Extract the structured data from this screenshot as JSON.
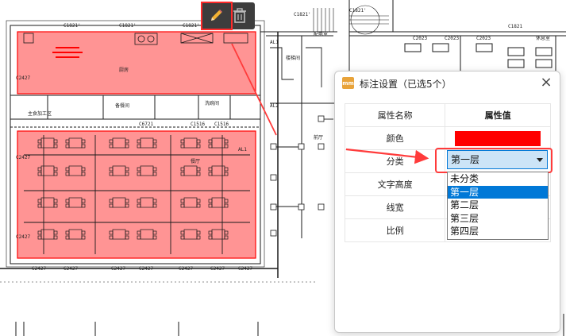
{
  "cad": {
    "labels": [
      "C1821'",
      "C1821'",
      "C1821'",
      "C1821'",
      "C2427",
      "C2427",
      "C2427",
      "C2427",
      "C2427",
      "C2427",
      "C2427",
      "C2427",
      "C2427",
      "C2427",
      "C1821'",
      "C1821'",
      "C6721",
      "C1516",
      "C1516",
      "AL1",
      "AL2",
      "AL1",
      "C1821",
      "C2023",
      "C2023",
      "C2023"
    ],
    "room_labels": [
      "厨房",
      "备餐间",
      "洗碗间",
      "主食加工区",
      "餐厅",
      "配电室",
      "楼梯间",
      "前厅",
      "休息室"
    ]
  },
  "toolbar": {
    "edit_icon": "pencil-icon",
    "delete_icon": "trash-icon"
  },
  "dialog": {
    "title": "标注设置（已选5个）",
    "app_icon_text": "mm",
    "close_symbol": "×",
    "header_name": "属性名称",
    "header_value": "属性值",
    "rows": [
      {
        "name": "颜色"
      },
      {
        "name": "分类"
      },
      {
        "name": "文字高度"
      },
      {
        "name": "线宽"
      },
      {
        "name": "比例"
      }
    ],
    "color_value": "#ff0000",
    "select_value": "第一层",
    "options": [
      "未分类",
      "第一层",
      "第二层",
      "第三层",
      "第四层"
    ],
    "selected_option_index": 1
  },
  "colors": {
    "annotation_fill": "#ff0000",
    "accent": "#0078d7",
    "callout": "#ff3b3b"
  }
}
